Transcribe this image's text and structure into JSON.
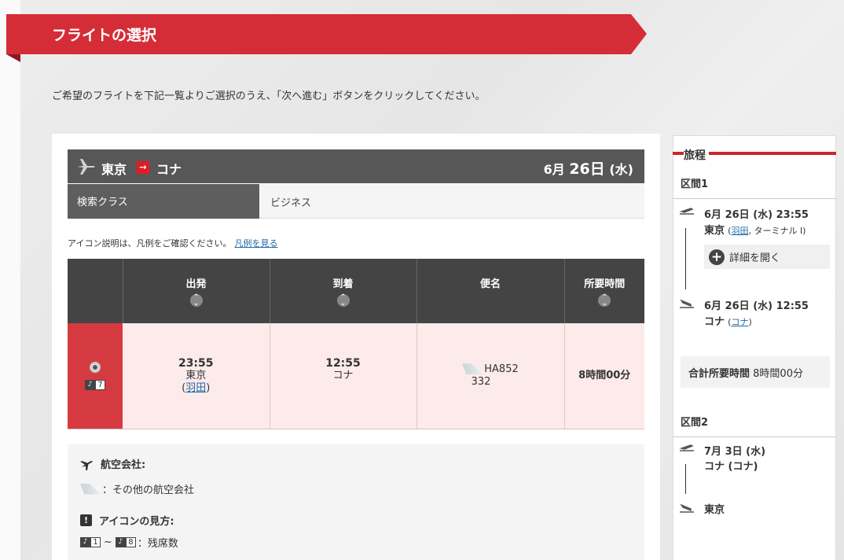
{
  "page": {
    "title": "フライトの選択",
    "instruction": "ご希望のフライトを下記一覧よりご選択のうえ、「次へ進む」ボタンをクリックしてください。"
  },
  "route": {
    "from": "東京",
    "arrow": "→",
    "to": "コナ",
    "date_month": "6月",
    "date_day": "26日",
    "date_weekday": "(水)"
  },
  "search_class": {
    "label": "検索クラス",
    "value": "ビジネス"
  },
  "legend_note": {
    "text": "アイコン説明は、凡例をご確認ください。",
    "link": "凡例を見る"
  },
  "table": {
    "headers": {
      "departure": "出発",
      "arrival": "到着",
      "flight": "便名",
      "duration": "所要時間"
    },
    "rows": [
      {
        "seats": "7",
        "dep_time": "23:55",
        "dep_city": "東京",
        "dep_airport_open": "(",
        "dep_airport": "羽田",
        "dep_airport_close": ")",
        "arr_time": "12:55",
        "arr_city": "コナ",
        "flight_no": "HA852",
        "aircraft": "332",
        "duration": "8時間00分"
      }
    ]
  },
  "legend": {
    "airline_title": "航空会社:",
    "airline_item": "：その他の航空会社",
    "icon_title": "アイコンの見方:",
    "seat_from": "1",
    "seat_tilde": "~",
    "seat_to": "8",
    "seat_text": "：残席数"
  },
  "itinerary": {
    "title": "旅程",
    "segment1": {
      "title": "区間1",
      "dep_datetime": "6月 26日 (水) 23:55",
      "dep_city": "東京",
      "dep_paren_open": "(",
      "dep_airport": "羽田",
      "dep_terminal": ", ターミナル I)",
      "detail_button": "詳細を開く",
      "arr_datetime": "6月 26日 (水) 12:55",
      "arr_city": "コナ",
      "arr_paren_open": "(",
      "arr_airport": "コナ",
      "arr_paren_close": ")",
      "total_label": "合計所要時間",
      "total_value": "8時間00分"
    },
    "segment2": {
      "title": "区間2",
      "dep_date": "7月 3日 (水)",
      "dep_city": "コナ (コナ)",
      "arr_city": "東京"
    }
  },
  "colors": {
    "brand_red": "#d52d37",
    "selected_row": "#fdeaea",
    "header_dark": "#444444",
    "link": "#2068a8"
  }
}
